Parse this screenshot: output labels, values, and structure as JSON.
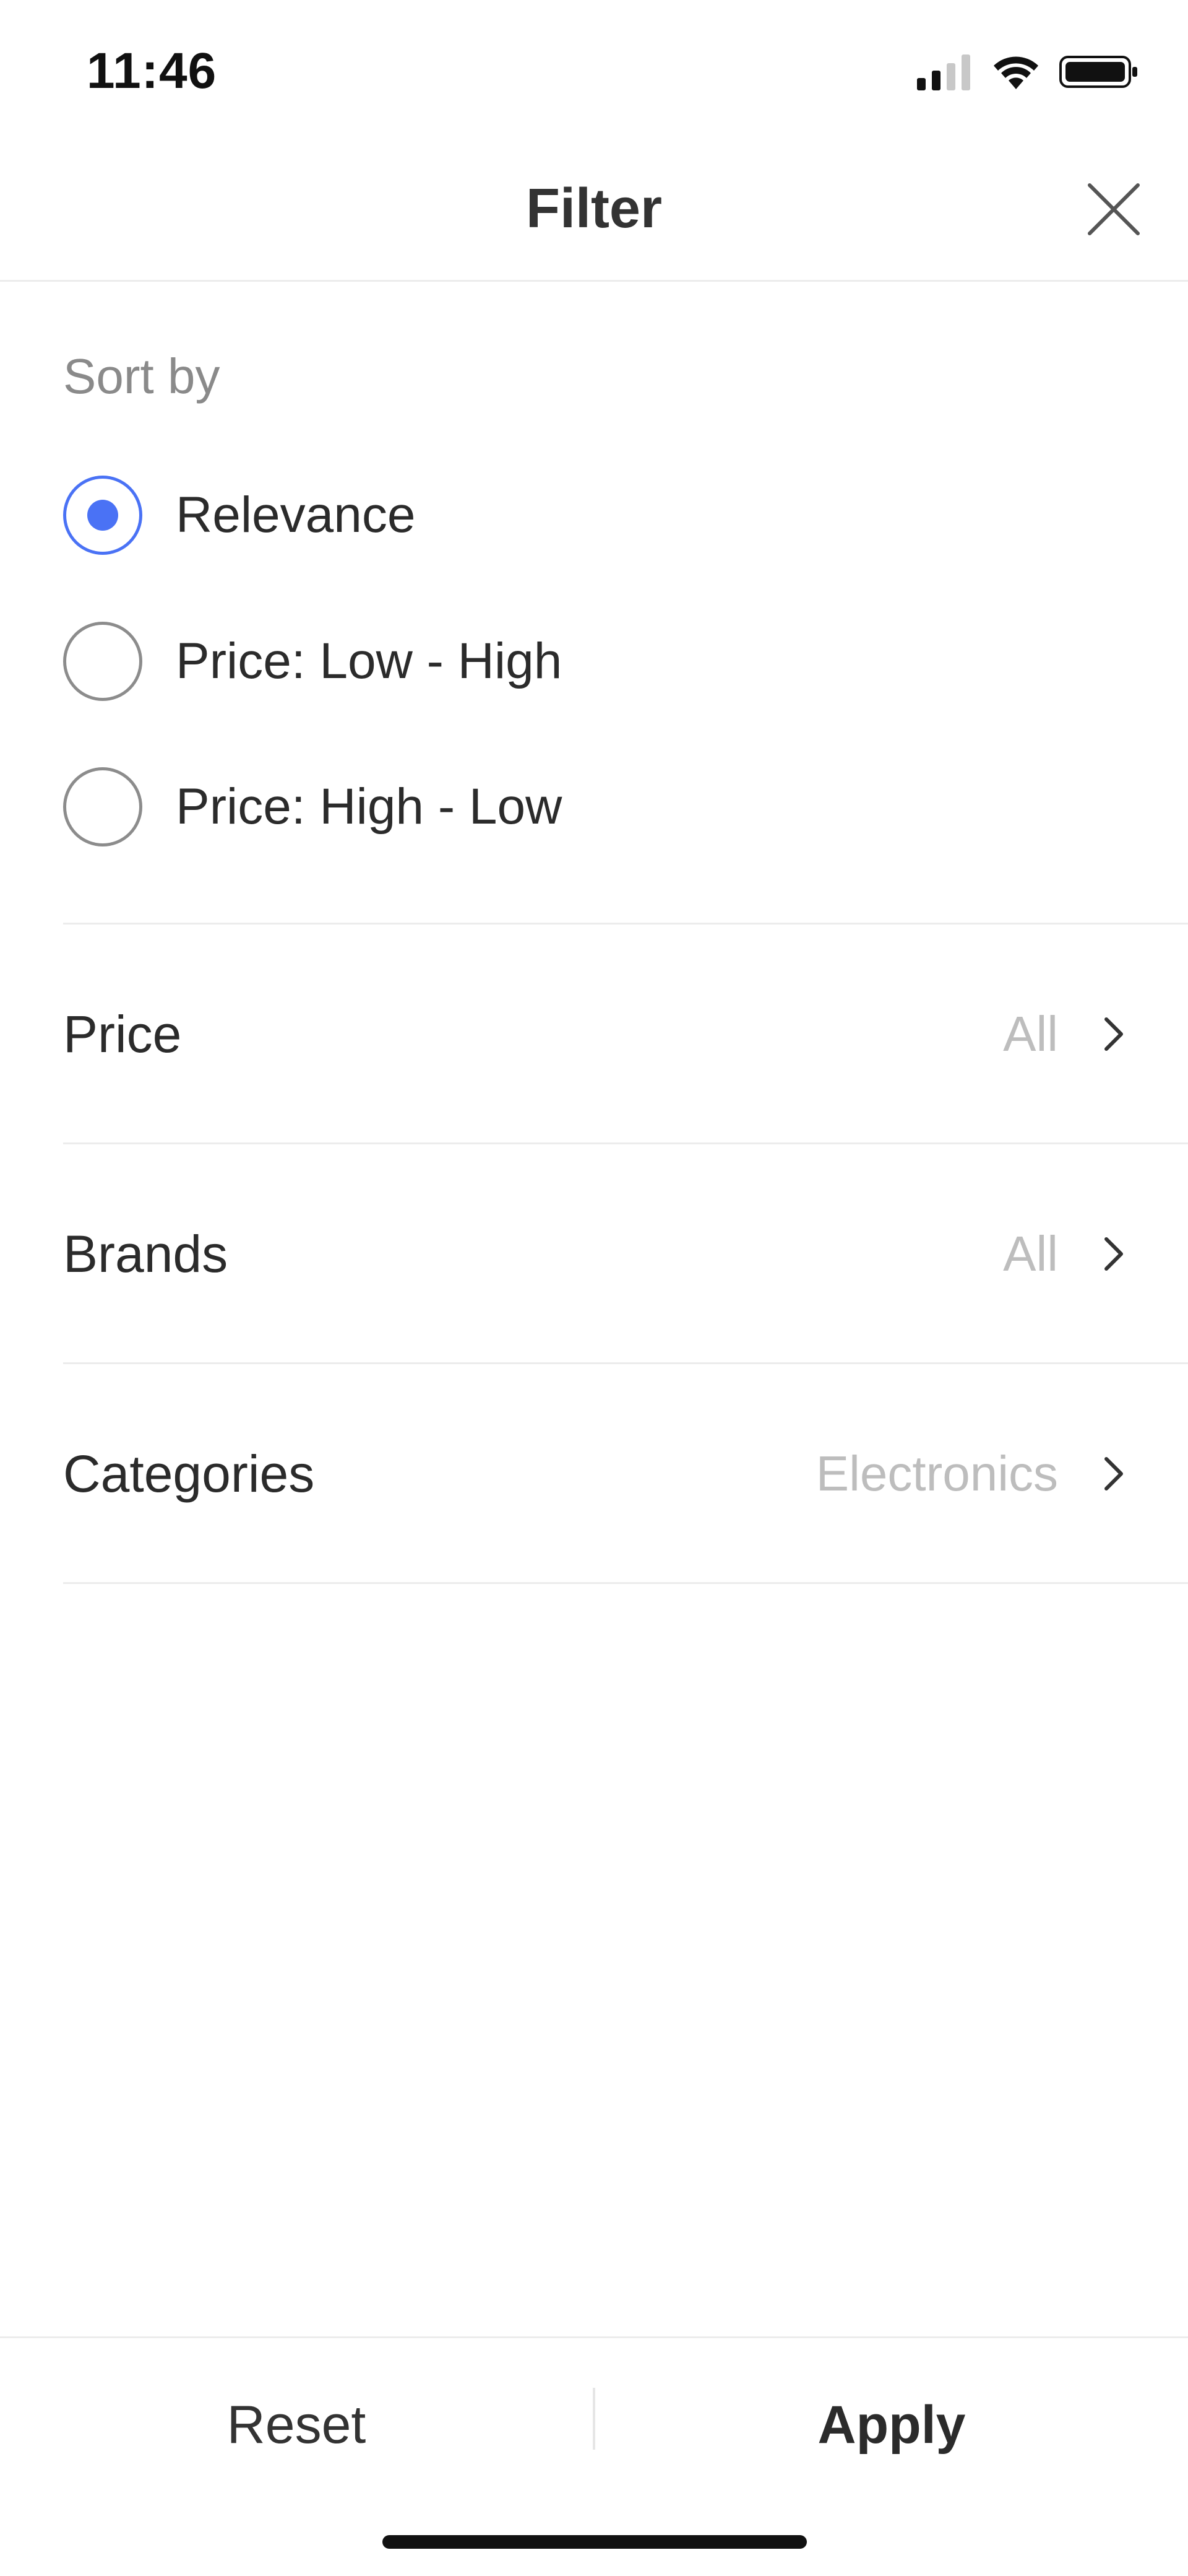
{
  "status_bar": {
    "time": "11:46",
    "icons": [
      "signal-icon",
      "wifi-icon",
      "battery-icon"
    ]
  },
  "header": {
    "title": "Filter",
    "close_icon": "close-icon"
  },
  "sort": {
    "label": "Sort by",
    "options": [
      {
        "label": "Relevance",
        "selected": true
      },
      {
        "label": "Price: Low - High",
        "selected": false
      },
      {
        "label": "Price: High - Low",
        "selected": false
      }
    ]
  },
  "filters": [
    {
      "label": "Price",
      "value": "All"
    },
    {
      "label": "Brands",
      "value": "All"
    },
    {
      "label": "Categories",
      "value": "Electronics"
    }
  ],
  "actions": {
    "reset_label": "Reset",
    "apply_label": "Apply"
  },
  "colors": {
    "accent": "#4a72f5",
    "muted_text": "#8a8a8a",
    "value_text": "#bdbdbd",
    "divider": "#ececec"
  }
}
